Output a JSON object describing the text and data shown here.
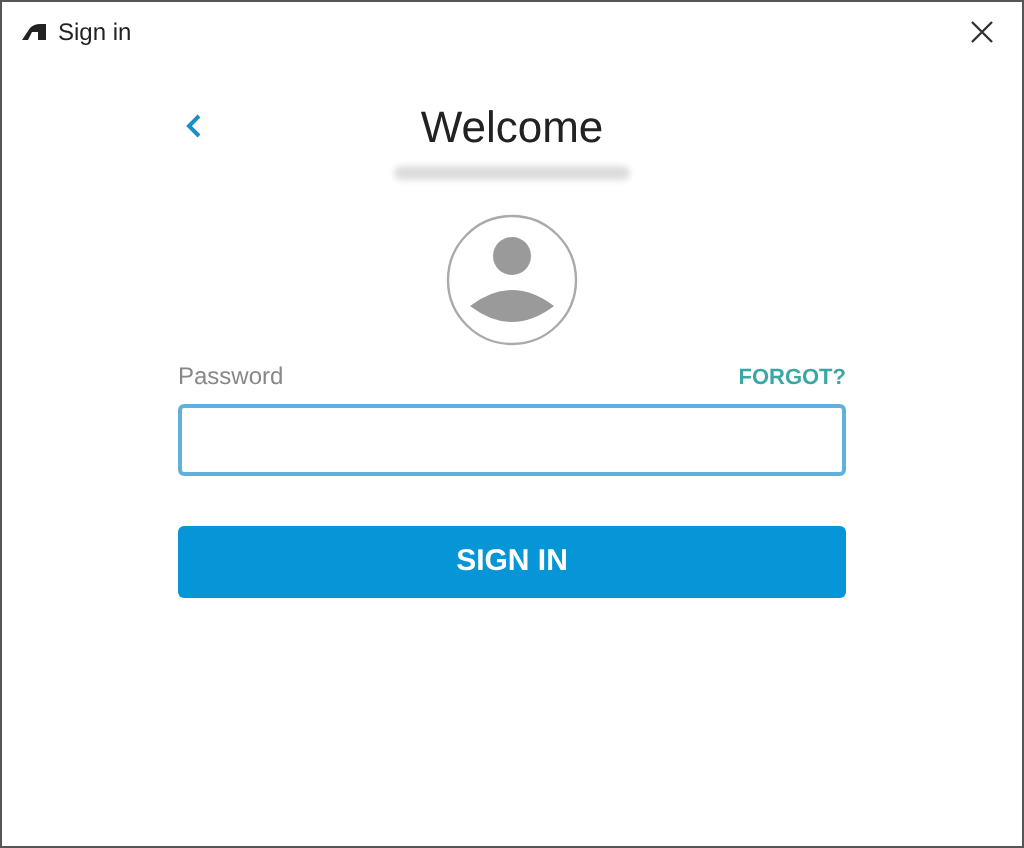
{
  "window": {
    "title": "Sign in"
  },
  "heading": "Welcome",
  "password": {
    "label": "Password",
    "forgot_link": "FORGOT?",
    "focused": true
  },
  "submit_button": "SIGN IN"
}
